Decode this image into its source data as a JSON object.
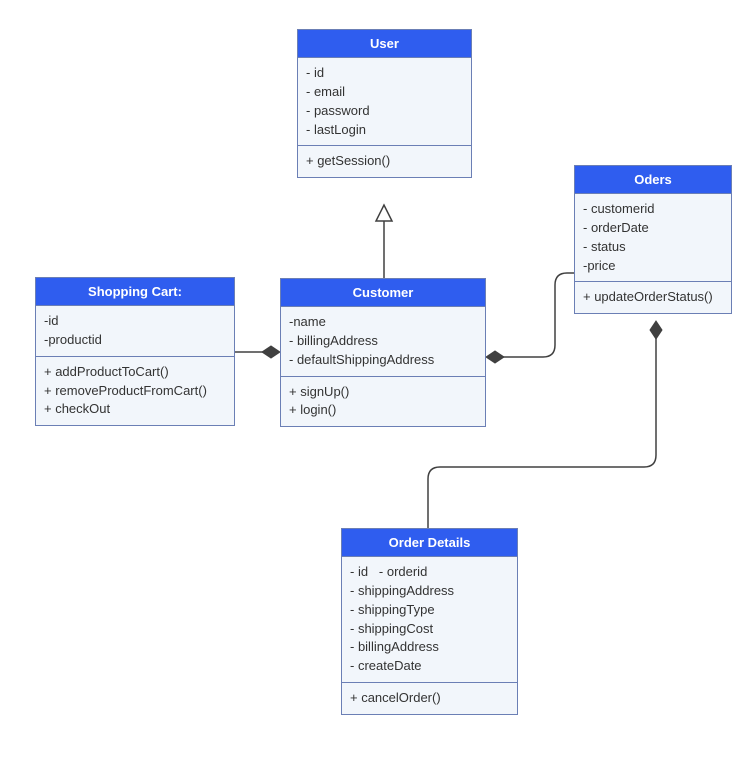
{
  "classes": {
    "user": {
      "title": "User",
      "attributes": [
        "- id",
        "- email",
        "- password",
        "- lastLogin"
      ],
      "methods": [
        "+ getSession()"
      ]
    },
    "oders": {
      "title": "Oders",
      "attributes": [
        "- customerid",
        "- orderDate",
        "- status",
        "-price"
      ],
      "methods": [
        "+ updateOrderStatus()"
      ]
    },
    "shoppingCart": {
      "title": "Shopping Cart:",
      "attributes": [
        "-id",
        "-productid"
      ],
      "methods": [
        "+ addProductToCart()",
        "+ removeProductFromCart()",
        "+ checkOut"
      ]
    },
    "customer": {
      "title": "Customer",
      "attributes": [
        "-name",
        "- billingAddress",
        "- defaultShippingAddress"
      ],
      "methods": [
        "+ signUp()",
        "+ login()"
      ]
    },
    "orderDetails": {
      "title": "Order Details",
      "attributes": [
        "- id   - orderid",
        "- shippingAddress",
        "- shippingType",
        "- shippingCost",
        "- billingAddress",
        "- createDate"
      ],
      "methods": [
        "+ cancelOrder()"
      ]
    }
  },
  "chart_data": {
    "type": "uml-class-diagram",
    "nodes": [
      {
        "id": "User",
        "attributes": [
          "id",
          "email",
          "password",
          "lastLogin"
        ],
        "methods": [
          "getSession()"
        ]
      },
      {
        "id": "Oders",
        "attributes": [
          "customerid",
          "orderDate",
          "status",
          "price"
        ],
        "methods": [
          "updateOrderStatus()"
        ]
      },
      {
        "id": "Shopping Cart:",
        "attributes": [
          "id",
          "productid"
        ],
        "methods": [
          "addProductToCart()",
          "removeProductFromCart()",
          "checkOut"
        ]
      },
      {
        "id": "Customer",
        "attributes": [
          "name",
          "billingAddress",
          "defaultShippingAddress"
        ],
        "methods": [
          "signUp()",
          "login()"
        ]
      },
      {
        "id": "Order Details",
        "attributes": [
          "id",
          "orderid",
          "shippingAddress",
          "shippingType",
          "shippingCost",
          "billingAddress",
          "createDate"
        ],
        "methods": [
          "cancelOrder()"
        ]
      }
    ],
    "edges": [
      {
        "from": "Customer",
        "to": "User",
        "type": "generalization"
      },
      {
        "from": "Customer",
        "to": "Shopping Cart:",
        "type": "composition",
        "ownerEnd": "Customer"
      },
      {
        "from": "Customer",
        "to": "Oders",
        "type": "composition",
        "ownerEnd": "Customer"
      },
      {
        "from": "Oders",
        "to": "Order Details",
        "type": "composition",
        "ownerEnd": "Oders"
      }
    ]
  }
}
